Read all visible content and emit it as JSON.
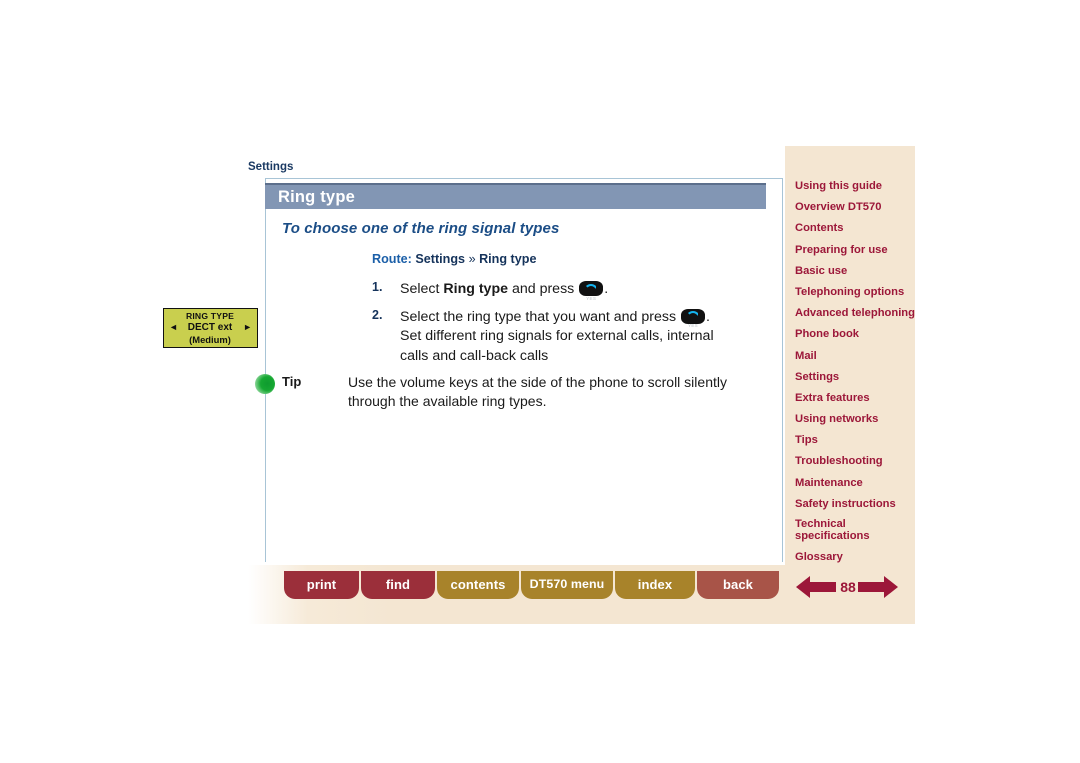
{
  "breadcrumb": "Settings",
  "page": {
    "title": "Ring type",
    "subheading": "To choose one of the ring signal types",
    "route": {
      "label": "Route:",
      "path_part1": "Settings",
      "separator": "»",
      "path_part2": "Ring type"
    },
    "steps": [
      {
        "number": "1.",
        "text_before": "Select ",
        "bold": "Ring type",
        "text_after": " and press ",
        "has_key": true,
        "key": "yes-key",
        "text_end": ".",
        "extra_lines": []
      },
      {
        "number": "2.",
        "text_before": "Select the ring type that you want and press ",
        "bold": "",
        "text_after": "",
        "has_key": true,
        "key": "yes-key",
        "text_end": ".",
        "extra_lines": [
          "Set different ring signals for external calls, internal",
          "calls and call-back calls"
        ]
      }
    ],
    "tip": {
      "label": "Tip",
      "line1": "Use the volume keys at the side of the phone to scroll silently",
      "line2": "through the available ring types."
    }
  },
  "lcd_display": {
    "line1": "RING TYPE",
    "line2": "DECT ext",
    "line3": "(Medium)",
    "arrow_left": "◄",
    "arrow_right": "►"
  },
  "sidebar": {
    "items": [
      {
        "label": "Using this guide",
        "multiline": false
      },
      {
        "label": "Overview DT570",
        "multiline": false
      },
      {
        "label": "Contents",
        "multiline": false
      },
      {
        "label": "Preparing for use",
        "multiline": false
      },
      {
        "label": "Basic use",
        "multiline": false
      },
      {
        "label": "Telephoning options",
        "multiline": false
      },
      {
        "label": "Advanced telephoning",
        "multiline": false
      },
      {
        "label": "Phone book",
        "multiline": false
      },
      {
        "label": "Mail",
        "multiline": false
      },
      {
        "label": "Settings",
        "multiline": false
      },
      {
        "label": "Extra features",
        "multiline": false
      },
      {
        "label": "Using networks",
        "multiline": false
      },
      {
        "label": "Tips",
        "multiline": false
      },
      {
        "label": "Troubleshooting",
        "multiline": false
      },
      {
        "label": "Maintenance",
        "multiline": false
      },
      {
        "label": "Safety instructions",
        "multiline": false
      },
      {
        "label": "Technical specifications",
        "multiline": true
      },
      {
        "label": "Glossary",
        "multiline": false
      }
    ]
  },
  "footer": {
    "buttons": [
      {
        "label": "print"
      },
      {
        "label": "find"
      },
      {
        "label": "contents"
      },
      {
        "label": "DT570 menu"
      },
      {
        "label": "index"
      },
      {
        "label": "back"
      }
    ],
    "page_number": "88",
    "prev_icon": "left-arrow-icon",
    "next_icon": "right-arrow-icon"
  },
  "colors": {
    "title_bar": "#8296b4",
    "sidebar_bg": "#f4e6d2",
    "nav_link": "#9c1739",
    "heading_blue": "#1b4d86",
    "route_label": "#1b5fa8",
    "btn_red": "#9b2f3a",
    "btn_gold": "#a8832a",
    "btn_back": "#a85448",
    "lcd_bg": "#c9cf4e",
    "tip_dot": "#16a832"
  }
}
